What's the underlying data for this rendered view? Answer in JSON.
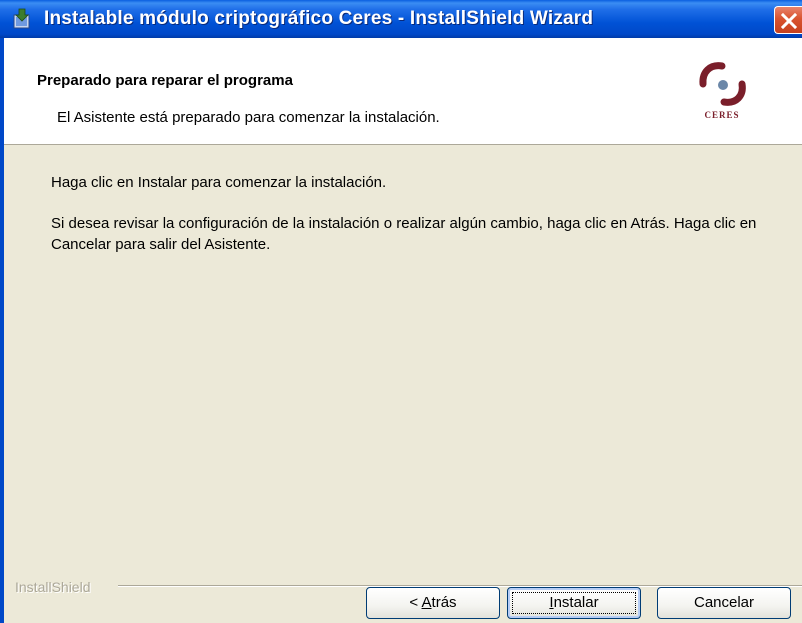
{
  "window": {
    "title": "Instalable módulo criptográfico Ceres - InstallShield Wizard"
  },
  "header": {
    "title": "Preparado para reparar el programa",
    "subtitle": "El Asistente está preparado para comenzar la instalación.",
    "logo_text": "CERES"
  },
  "body": {
    "paragraph1": "Haga clic en Instalar para comenzar la instalación.",
    "paragraph2": "Si desea revisar la configuración de la instalación o realizar algún cambio, haga clic en Atrás. Haga clic en Cancelar para salir del Asistente."
  },
  "footer": {
    "brand": "InstallShield"
  },
  "buttons": {
    "back_prefix": "< ",
    "back_accel": "A",
    "back_rest": "trás",
    "install_accel": "I",
    "install_rest": "nstalar",
    "cancel": "Cancelar"
  },
  "colors": {
    "titlebar": "#0052d6",
    "dialog_bg": "#ece9d8",
    "close_button": "#d9532f",
    "logo_accent": "#7a1e2a"
  },
  "icons": {
    "title": "installer-package-icon",
    "close": "close-icon",
    "logo": "ceres-logo"
  }
}
